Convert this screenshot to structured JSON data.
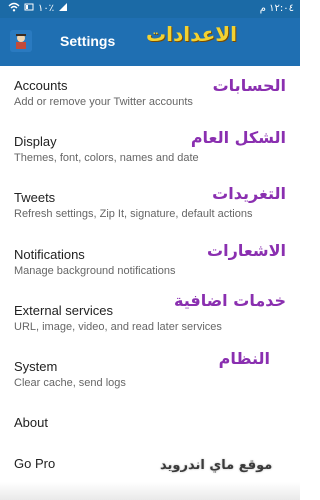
{
  "status": {
    "time": "١٢:٠٤ م",
    "battery": "١٠٪"
  },
  "appbar": {
    "title": "Settings",
    "overlay_ar": "الاعدادات"
  },
  "items": [
    {
      "title": "Accounts",
      "subtitle": "Add or remove your Twitter accounts",
      "ar": "الحسابات"
    },
    {
      "title": "Display",
      "subtitle": "Themes, font, colors, names and date",
      "ar": "الشكل العام"
    },
    {
      "title": "Tweets",
      "subtitle": "Refresh settings, Zip It, signature, default actions",
      "ar": "التغريدات"
    },
    {
      "title": "Notifications",
      "subtitle": "Manage background notifications",
      "ar": "الاشعارات"
    },
    {
      "title": "External services",
      "subtitle": "URL, image, video, and read later services",
      "ar": "خدمات اضافية"
    },
    {
      "title": "System",
      "subtitle": "Clear cache, send logs",
      "ar": "النظام"
    },
    {
      "title": "About",
      "subtitle": "",
      "ar": ""
    },
    {
      "title": "Go Pro",
      "subtitle": "",
      "ar": ""
    }
  ],
  "watermark": "موقع ماي اندرويد"
}
